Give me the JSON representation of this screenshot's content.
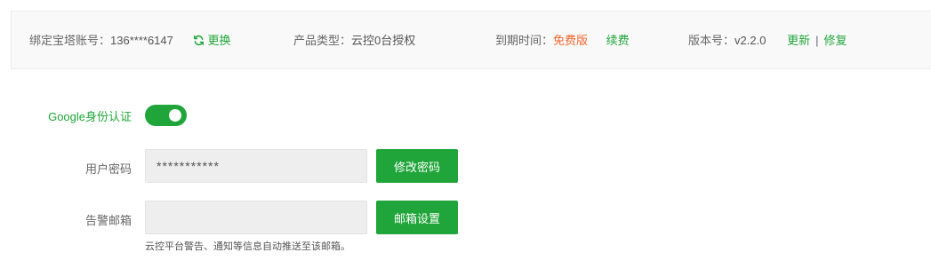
{
  "info_bar": {
    "account_label": "绑定宝塔账号：",
    "account_value": "136****6147",
    "change_label": "更换",
    "product_label": "产品类型：",
    "product_value": "云控0台授权",
    "expiry_label": "到期时间：",
    "expiry_value": "免费版",
    "renew_label": "续费",
    "version_label": "版本号：",
    "version_value": "v2.2.0",
    "update_label": "更新",
    "separator": "|",
    "repair_label": "修复"
  },
  "google_auth": {
    "label": "Google身份认证",
    "enabled": true
  },
  "password": {
    "label": "用户密码",
    "value": "***********",
    "button_label": "修改密码"
  },
  "email": {
    "label": "告警邮箱",
    "value": "",
    "button_label": "邮箱设置",
    "hint": "云控平台警告、通知等信息自动推送至该邮箱。"
  },
  "colors": {
    "accent": "#20a53a",
    "warning": "#f0652e",
    "info_bar_bg": "#f9f9f9",
    "input_bg": "#eeeeee"
  }
}
